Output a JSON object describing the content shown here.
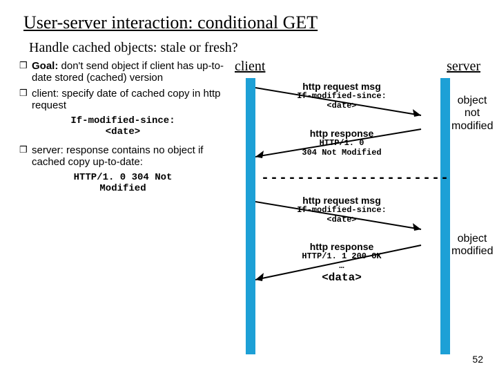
{
  "title": "User-server interaction: conditional GET",
  "subtitle": "Handle cached objects: stale or fresh?",
  "bullets": {
    "b1": {
      "pre": "Goal:",
      "text": " don't send object if client has up-to-date stored (cached) version"
    },
    "b2": {
      "text": "client: specify date of cached copy in http request"
    },
    "b2_mono": "If-modified-since:\n<date>",
    "b3": {
      "text": "server: response contains no object if cached copy up-to-date:"
    },
    "b3_mono": "HTTP/1. 0 304 Not\nModified"
  },
  "headers": {
    "client": "client",
    "server": "server"
  },
  "msg1": {
    "t1": "http request msg",
    "t2a": "If-modified-since:",
    "t2b": "<date>"
  },
  "msg2": {
    "t1": "http response",
    "t2a": "HTTP/1. 0",
    "t2b": "304 Not Modified"
  },
  "msg3": {
    "t1": "http request msg",
    "t2a": "If-modified-since:",
    "t2b": "<date>"
  },
  "msg4": {
    "t1": "http response",
    "t2a": "HTTP/1. 1 200 OK",
    "t2b": "…",
    "t2c": "<data>"
  },
  "side1": "object\nnot\nmodified",
  "side2": "object\nmodified",
  "dashes": "---------------------",
  "page": "52"
}
